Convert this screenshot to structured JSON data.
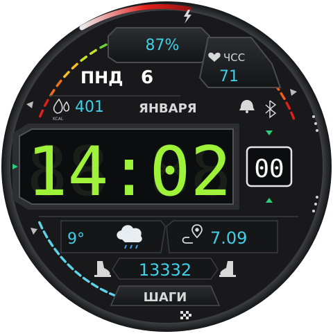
{
  "battery": {
    "value": "87%",
    "level_pct": 87
  },
  "heart_rate": {
    "label": "ЧСС",
    "value": "71"
  },
  "date": {
    "weekday": "ПНД",
    "day": "6",
    "month": "ЯНВАРЯ"
  },
  "calories": {
    "value": "401",
    "unit": "KCAL"
  },
  "time": {
    "hours_minutes": "14:02",
    "ghost": "88:88",
    "seconds": "00",
    "seconds_ghost": "88"
  },
  "weather": {
    "temperature": "9°",
    "icon": "cloud-rain-icon"
  },
  "distance": {
    "value": "7.09",
    "icon": "route-pin-icon"
  },
  "steps": {
    "value": "13332",
    "label": "ШАГИ"
  },
  "colors": {
    "accent_cyan": "#3fd0e8",
    "digital_green": "#9ff23a",
    "red_arc": "#e0201a",
    "bezel": "#1e2024",
    "panel": "#111214"
  }
}
